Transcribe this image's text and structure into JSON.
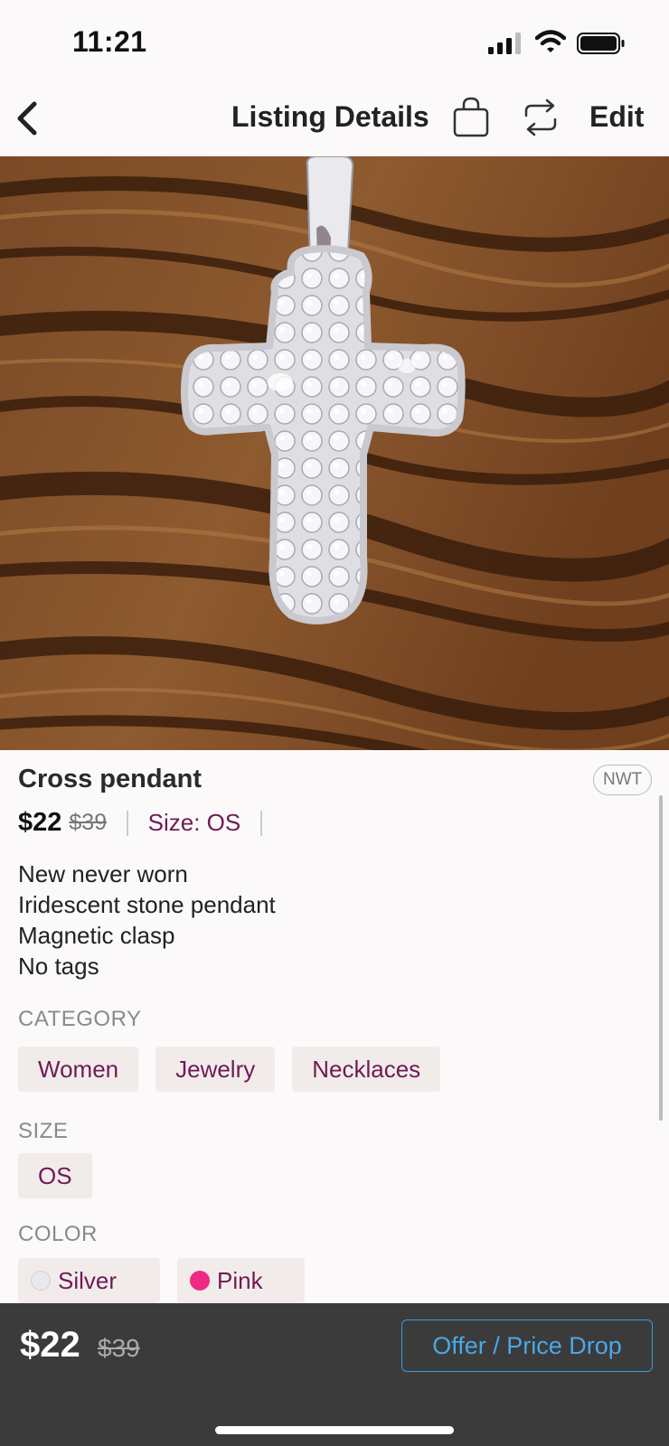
{
  "status_bar": {
    "time": "11:21"
  },
  "nav": {
    "title": "Listing Details",
    "edit_label": "Edit"
  },
  "listing": {
    "title": "Cross pendant",
    "condition_badge": "NWT",
    "price": "$22",
    "original_price": "$39",
    "size_inline": "Size: OS",
    "description": [
      "New never worn",
      "Iridescent stone pendant",
      "Magnetic clasp",
      "No tags"
    ]
  },
  "category": {
    "label": "CATEGORY",
    "items": [
      "Women",
      "Jewelry",
      "Necklaces"
    ]
  },
  "size": {
    "label": "SIZE",
    "items": [
      "OS"
    ]
  },
  "color": {
    "label": "COLOR",
    "items": [
      {
        "name": "Silver",
        "swatch": "#e9e9ec"
      },
      {
        "name": "Pink",
        "swatch": "#ee2a86"
      }
    ]
  },
  "bottom_bar": {
    "price": "$22",
    "original_price": "$39",
    "offer_button": "Offer / Price Drop"
  },
  "colors": {
    "accent": "#6e1b55",
    "link_blue": "#4aa8e6",
    "bottom_bg": "#3b3b3b"
  }
}
